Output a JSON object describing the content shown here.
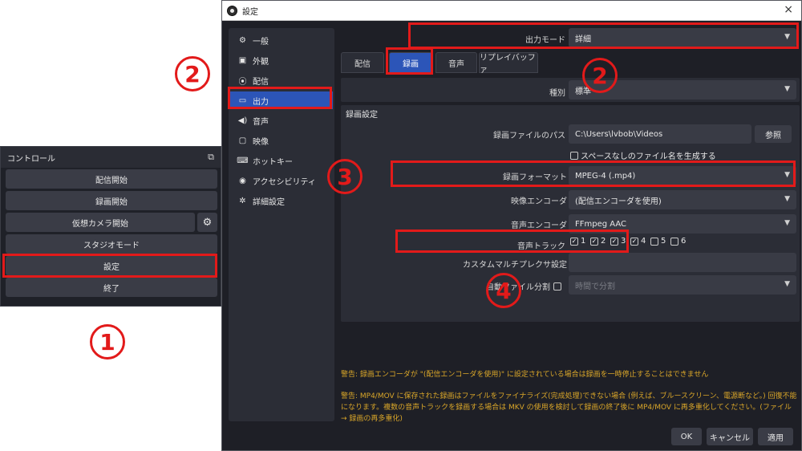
{
  "controls": {
    "title": "コントロール",
    "buttons": {
      "start_stream": "配信開始",
      "start_record": "録画開始",
      "start_vcam": "仮想カメラ開始",
      "studio_mode": "スタジオモード",
      "settings": "設定",
      "exit": "終了"
    }
  },
  "window": {
    "title": "設定",
    "close": "×"
  },
  "sidebar": {
    "items": [
      {
        "icon": "gear-icon",
        "label": "一般"
      },
      {
        "icon": "appearance-icon",
        "label": "外観"
      },
      {
        "icon": "stream-icon",
        "label": "配信"
      },
      {
        "icon": "output-icon",
        "label": "出力"
      },
      {
        "icon": "audio-icon",
        "label": "音声"
      },
      {
        "icon": "video-icon",
        "label": "映像"
      },
      {
        "icon": "keyboard-icon",
        "label": "ホットキー"
      },
      {
        "icon": "accessibility-icon",
        "label": "アクセシビリティ"
      },
      {
        "icon": "advanced-icon",
        "label": "詳細設定"
      }
    ],
    "active": "出力"
  },
  "output": {
    "mode_label": "出力モード",
    "mode_value": "詳細",
    "tabs": [
      "配信",
      "録画",
      "音声",
      "リプレイバッファ"
    ],
    "active_tab": "録画",
    "type_label": "種別",
    "type_value": "標準",
    "section_title": "録画設定",
    "path_label": "録画ファイルのパス",
    "path_value": "C:\\Users\\lvbob\\Videos",
    "browse_label": "参照",
    "nospace_label": "スペースなしのファイル名を生成する",
    "format_label": "録画フォーマット",
    "format_value": "MPEG-4 (.mp4)",
    "video_encoder_label": "映像エンコーダ",
    "video_encoder_value": "(配信エンコーダを使用)",
    "audio_encoder_label": "音声エンコーダ",
    "audio_encoder_value": "FFmpeg AAC",
    "tracks_label": "音声トラック",
    "tracks": [
      {
        "label": "1",
        "checked": true
      },
      {
        "label": "2",
        "checked": true
      },
      {
        "label": "3",
        "checked": true
      },
      {
        "label": "4",
        "checked": true
      },
      {
        "label": "5",
        "checked": false
      },
      {
        "label": "6",
        "checked": false
      }
    ],
    "muxer_label": "カスタムマルチプレクサ設定",
    "muxer_value": "",
    "autosplit_label": "自動ファイル分割",
    "autosplit_value": "時間で分割"
  },
  "warnings": {
    "line1": "警告: 録画エンコーダが \"(配信エンコーダを使用)\" に設定されている場合は録画を一時停止することはできません",
    "line2": "警告: MP4/MOV に保存された録画はファイルをファイナライズ(完成処理)できない場合 (例えば、ブルースクリーン、電源断など。) 回復不能になります。複数の音声トラックを録画する場合は MKV の使用を検討して録画の終了後に MP4/MOV に再多重化してください。(ファイル → 録画の再多重化)"
  },
  "footer": {
    "ok": "OK",
    "cancel": "キャンセル",
    "apply": "適用"
  },
  "annotations": {
    "step1": "1",
    "step2a": "2",
    "step2b": "2",
    "step3": "3",
    "step4": "4"
  },
  "colors": {
    "highlight": "#e21a1a",
    "accent": "#2c55b8",
    "warning": "#d9a629"
  }
}
